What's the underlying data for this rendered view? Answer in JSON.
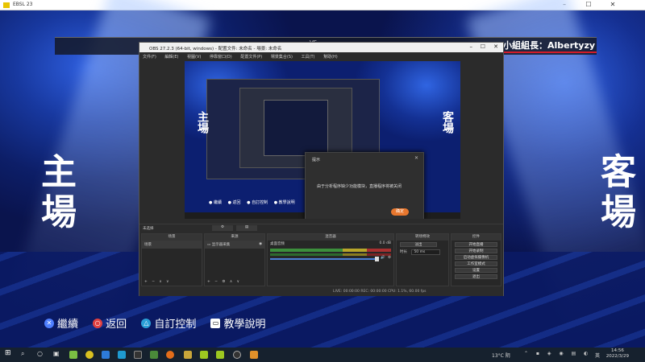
{
  "outer_window": {
    "title": "EBSL 23"
  },
  "stage": {
    "home_label": "主場",
    "away_label": "客場",
    "top_bar_center": "VS",
    "leader_label": "小組組長：Albertyzy",
    "bottom_buttons": [
      {
        "label": "繼續",
        "icon": "cross-icon",
        "color": "#4f7fff"
      },
      {
        "label": "返回",
        "icon": "circle-icon",
        "color": "#e04040"
      },
      {
        "label": "自訂控制",
        "icon": "triangle-icon",
        "color": "#2a9fd8"
      },
      {
        "label": "教學說明",
        "icon": "touchpad-icon",
        "color": "#ffffff"
      }
    ]
  },
  "obs": {
    "title": "OBS 27.2.3 (64-bit, windows) - 配置文件: 未命名 - 場景: 未命名",
    "menu": [
      "文件(F)",
      "編輯(E)",
      "視圖(V)",
      "停靠窗口(D)",
      "配置文件(P)",
      "場景集合(S)",
      "工具(T)",
      "幫助(H)"
    ],
    "preview": {
      "home_label": "主場",
      "away_label": "客場",
      "buttons": [
        "繼續",
        "返回",
        "自訂控制",
        "教學說明"
      ]
    },
    "dialog": {
      "title": "提示",
      "message": "由于分析程序缺少功能模块，直播程序将被关闭",
      "ok_label": "确定"
    },
    "transition_bar": "未选择",
    "docks": {
      "scenes": {
        "title": "场景",
        "items": [
          "场景"
        ]
      },
      "sources": {
        "title": "来源",
        "items": [
          "显示器采集"
        ]
      },
      "mixer": {
        "title": "混音器",
        "channel": "桌面音频",
        "level": "0.0 dB"
      },
      "transitions": {
        "title": "转场特效",
        "type": "淡出",
        "duration_label": "时长",
        "duration": "50 ms"
      },
      "controls": {
        "title": "控件",
        "buttons": [
          "开始直播",
          "开始录制",
          "启动虚拟摄像机",
          "工作室模式",
          "设置",
          "退出"
        ]
      }
    },
    "status": "LIVE: 00:00:00   REC: 00:00:00   CPU: 1.1%, 60.00 fps"
  },
  "taskbar": {
    "weather": "13°C 阴",
    "lang": "英",
    "time": "14:56",
    "date": "2022/3/29"
  }
}
